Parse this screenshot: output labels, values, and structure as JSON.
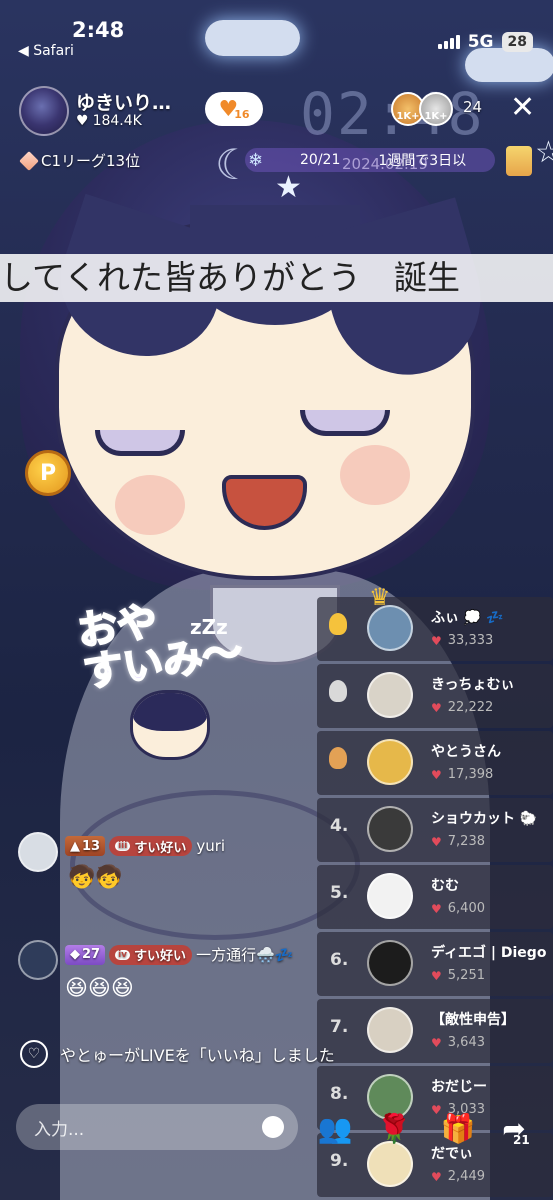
{
  "status_bar": {
    "time": "2:48",
    "back_label": "◀ Safari",
    "network": "5G",
    "battery": "28"
  },
  "host": {
    "name": "ゆきいり…",
    "likes": "184.4K",
    "heart_badge": "16",
    "league": "C1リーグ13位"
  },
  "overlay": {
    "clock": "02:48",
    "date": "2024.02.19",
    "progress": "20/21",
    "week_text": "1週間で3日以"
  },
  "top_right": {
    "gift_1": "1K+",
    "gift_2": "1K+",
    "viewer_count": "24",
    "close_icon": "close-icon"
  },
  "marquee_text": "してくれた皆ありがとう　誕生",
  "sticker": {
    "line1": "おや",
    "line2": "すいみ〜",
    "zzz": "zZz"
  },
  "coin_label": "P",
  "ranking": [
    {
      "rank": "1",
      "name": "ふぃ 💭 💤",
      "score": "33,333",
      "avatar_color": "#6d8fb0"
    },
    {
      "rank": "2",
      "name": "きっちょむぃ",
      "score": "22,222",
      "avatar_color": "#d9d3c8"
    },
    {
      "rank": "3",
      "name": "やとうさん",
      "score": "17,398",
      "avatar_color": "#e6b84a"
    },
    {
      "rank": "4.",
      "name": "ショウカット 🐑",
      "score": "7,238",
      "avatar_color": "#3a3a3a"
    },
    {
      "rank": "5.",
      "name": "むむ",
      "score": "6,400",
      "avatar_color": "#f2f2f2"
    },
    {
      "rank": "6.",
      "name": "ディエゴ | Diego",
      "score": "5,251",
      "avatar_color": "#1c1c1c"
    },
    {
      "rank": "7.",
      "name": "【敵性申告】",
      "score": "3,643",
      "avatar_color": "#d8d0c2"
    },
    {
      "rank": "8.",
      "name": "おだじー",
      "score": "3,033",
      "avatar_color": "#5f8a5a"
    },
    {
      "rank": "9.",
      "name": "だでぃ",
      "score": "2,449",
      "avatar_color": "#efe0b8"
    }
  ],
  "chat": [
    {
      "level": "13",
      "fan_level": "iii",
      "fan_label": "すい好い",
      "user": "yuri",
      "message": "",
      "avatar_color": "#d8dde4"
    },
    {
      "level": "27",
      "fan_level": "iv",
      "fan_label": "すい好い",
      "user": "一方通行🌨️💤",
      "message": "😆😆😆",
      "avatar_color": "#2f3c5a"
    }
  ],
  "like_notice": "やとゅーがLIVEを「いいね」しました",
  "input": {
    "placeholder": "入力..."
  },
  "share_count": "21",
  "colors": {
    "accent": "#e24b5b",
    "panel": "#2d2d3c",
    "gold": "#f5c23c"
  }
}
